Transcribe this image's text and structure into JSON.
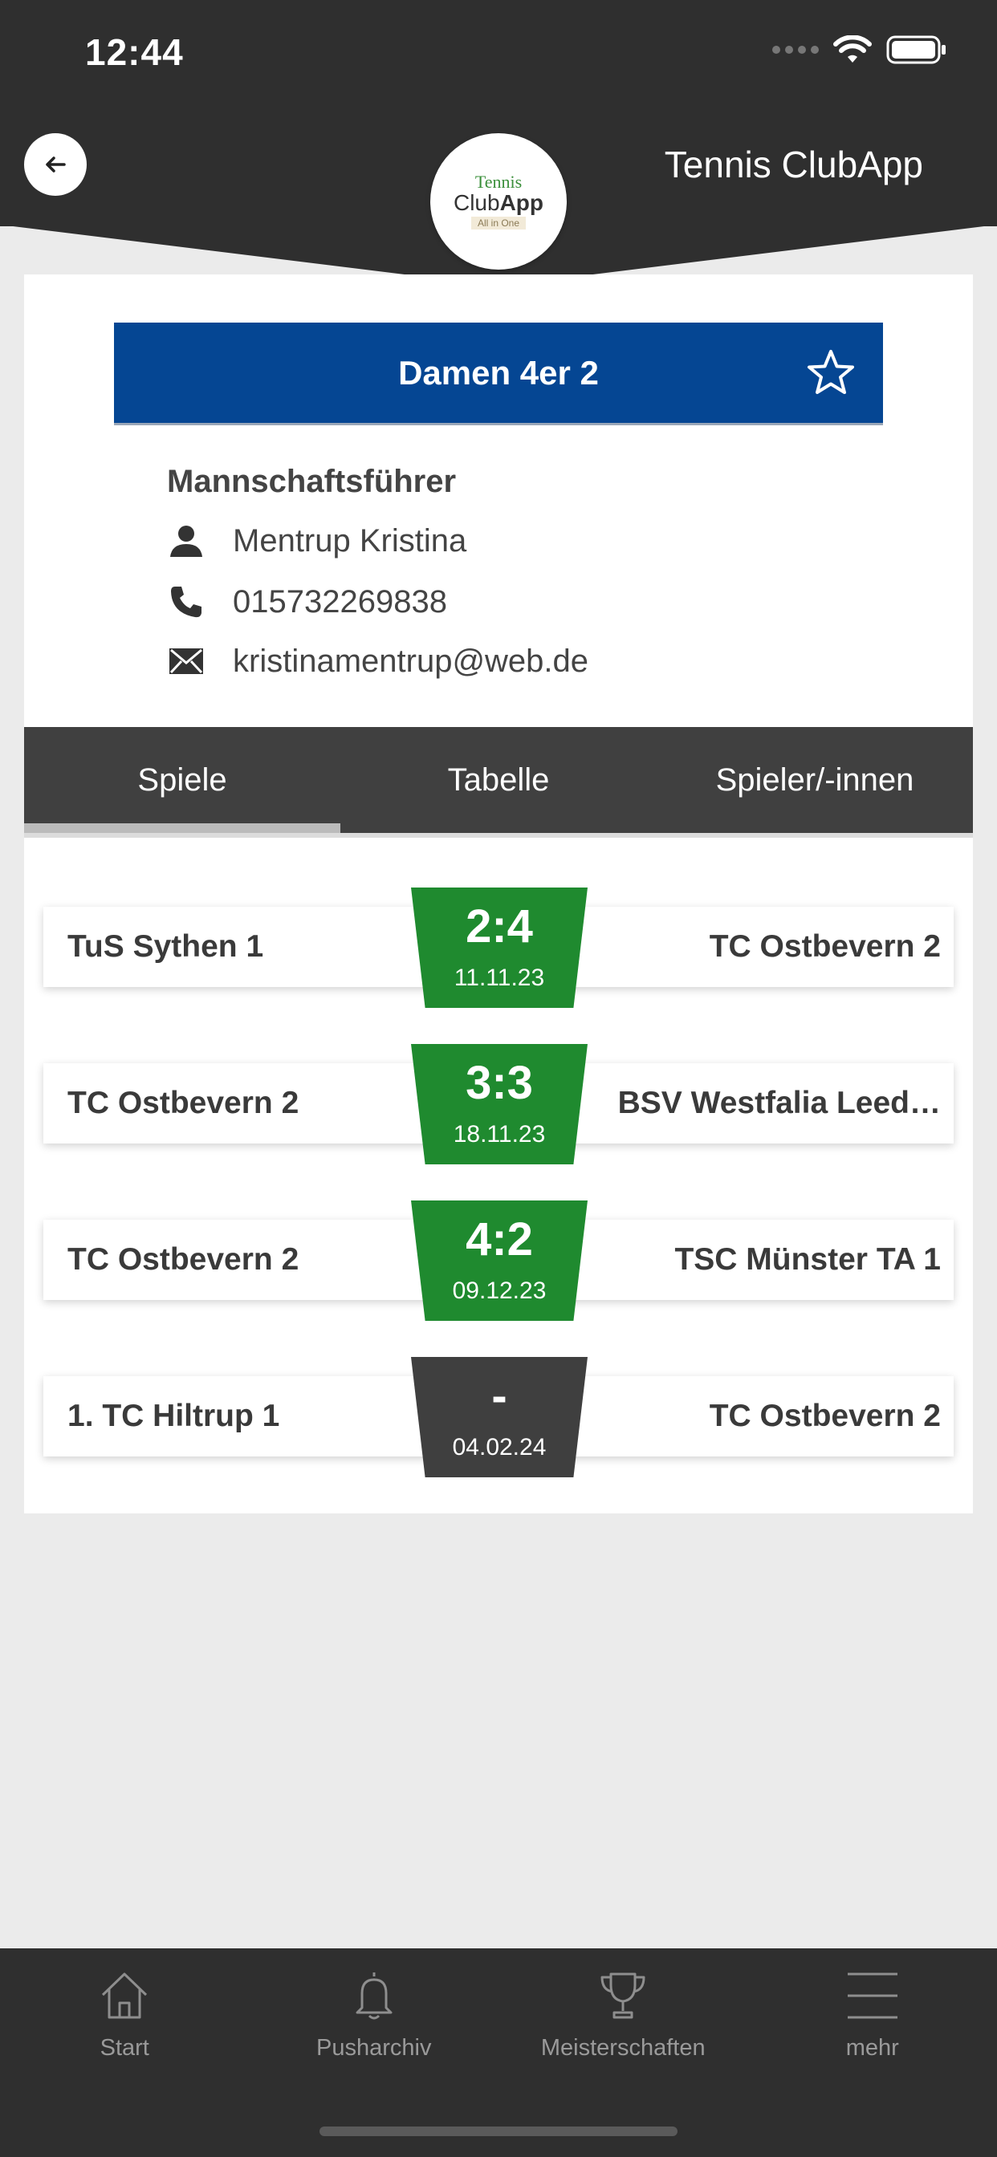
{
  "status": {
    "time": "12:44"
  },
  "header": {
    "app_title": "Tennis ClubApp",
    "logo": {
      "line1": "Tennis",
      "line2a": "Club",
      "line2b": "App",
      "tagline": "All in One"
    }
  },
  "team": {
    "name": "Damen 4er 2",
    "captain_heading": "Mannschaftsführer",
    "captain_name": "Mentrup Kristina",
    "phone": "015732269838",
    "email": "kristinamentrup@web.de"
  },
  "tabs": [
    {
      "label": "Spiele",
      "active": true
    },
    {
      "label": "Tabelle",
      "active": false
    },
    {
      "label": "Spieler/-innen",
      "active": false
    }
  ],
  "matches": [
    {
      "home": "TuS Sythen 1",
      "away": "TC Ostbevern 2",
      "score": "2:4",
      "date": "11.11.23",
      "status": "played"
    },
    {
      "home": "TC Ostbevern 2",
      "away": "BSV Westfalia Leed…",
      "score": "3:3",
      "date": "18.11.23",
      "status": "played"
    },
    {
      "home": "TC Ostbevern 2",
      "away": "TSC Münster TA 1",
      "score": "4:2",
      "date": "09.12.23",
      "status": "played"
    },
    {
      "home": "1. TC Hiltrup 1",
      "away": "TC Ostbevern 2",
      "score": "-",
      "date": "04.02.24",
      "status": "pending"
    }
  ],
  "bottom_nav": [
    {
      "label": "Start",
      "icon": "home-icon"
    },
    {
      "label": "Pusharchiv",
      "icon": "bell-icon"
    },
    {
      "label": "Meisterschaften",
      "icon": "trophy-icon"
    },
    {
      "label": "mehr",
      "icon": "menu-icon"
    }
  ],
  "colors": {
    "header_bg": "#2f2f2f",
    "team_banner": "#054693",
    "score_played": "#1f8a2f",
    "score_pending": "#3f3f3f",
    "tabs_bg": "#404040"
  }
}
